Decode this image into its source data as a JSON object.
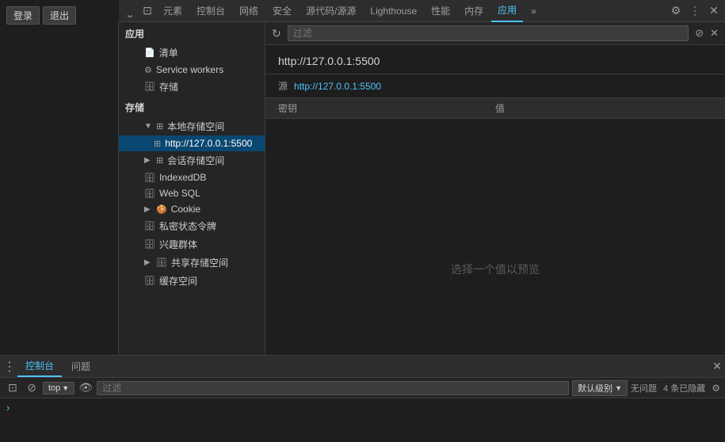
{
  "top_buttons": {
    "login": "登录",
    "exit": "退出"
  },
  "toolbar": {
    "tabs": [
      {
        "label": "⎵",
        "id": "icon1"
      },
      {
        "label": "⊡",
        "id": "icon2"
      },
      {
        "label": "元素",
        "id": "elements"
      },
      {
        "label": "控制台",
        "id": "console"
      },
      {
        "label": "网络",
        "id": "network"
      },
      {
        "label": "安全",
        "id": "security"
      },
      {
        "label": "源代码/源源",
        "id": "sources"
      },
      {
        "label": "Lighthouse",
        "id": "lighthouse"
      },
      {
        "label": "性能",
        "id": "performance"
      },
      {
        "label": "内存",
        "id": "memory"
      },
      {
        "label": "应用",
        "id": "application",
        "active": true
      },
      {
        "label": "»",
        "id": "more"
      }
    ],
    "right_icons": [
      "⚙",
      "⋮",
      "✕"
    ]
  },
  "sidebar": {
    "app_section": "应用",
    "items": [
      {
        "label": "清单",
        "icon": "📄",
        "indent": 1
      },
      {
        "label": "Service workers",
        "icon": "⚙",
        "indent": 1
      },
      {
        "label": "存储",
        "icon": "🗄",
        "indent": 1
      }
    ],
    "storage_section": "存储",
    "storage_items": [
      {
        "label": "本地存储空间",
        "icon": "⊞",
        "indent": 1,
        "expanded": true,
        "has_arrow": true
      },
      {
        "label": "http://127.0.0.1:5500",
        "icon": "⊞",
        "indent": 2,
        "active": true
      },
      {
        "label": "会话存储空间",
        "icon": "⊞",
        "indent": 1,
        "has_arrow": true
      },
      {
        "label": "IndexedDB",
        "icon": "🗄",
        "indent": 1
      },
      {
        "label": "Web SQL",
        "icon": "🗄",
        "indent": 1
      },
      {
        "label": "Cookie",
        "icon": "🍪",
        "indent": 1,
        "has_arrow": true
      },
      {
        "label": "私密状态令牌",
        "icon": "🗄",
        "indent": 1
      },
      {
        "label": "兴趣群体",
        "icon": "🗄",
        "indent": 1
      },
      {
        "label": "共享存储空间",
        "icon": "🗄",
        "indent": 1,
        "has_arrow": true
      },
      {
        "label": "缓存空间",
        "icon": "🗄",
        "indent": 1
      }
    ]
  },
  "app_header": {
    "filter_placeholder": "过滤",
    "filter_value": ""
  },
  "content": {
    "url": "http://127.0.0.1:5500",
    "source_label": "源",
    "source_url": "http://127.0.0.1:5500",
    "table": {
      "headers": [
        "密钥",
        "值"
      ],
      "preview_text": "选择一个值以预览"
    }
  },
  "console_panel": {
    "tabs": [
      {
        "label": "控制台",
        "active": true
      },
      {
        "label": "问题"
      }
    ],
    "toolbar": {
      "top_label": "top",
      "filter_placeholder": "过滤",
      "level_label": "默认级别",
      "status": "无问题",
      "hidden_count": "4 条已隐藏"
    },
    "prompt_arrow": "›"
  }
}
